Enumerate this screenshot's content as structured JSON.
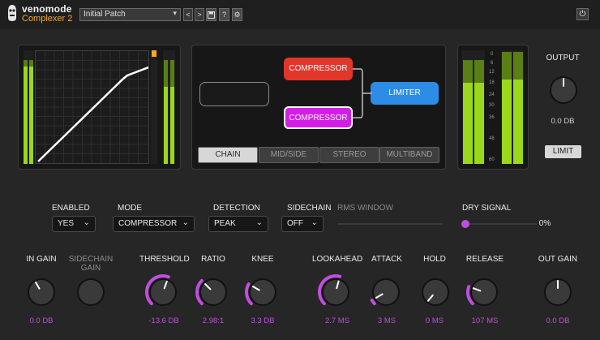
{
  "header": {
    "brand": "venomode",
    "product": "Complexer 2",
    "preset": "Initial Patch",
    "prev_label": "<",
    "next_label": ">",
    "save_label": "💾",
    "help_label": "?",
    "settings_label": "⚙",
    "power_label": "⏻"
  },
  "chain": {
    "block_top": "COMPRESSOR",
    "block_bottom": "COMPRESSOR",
    "block_limiter": "LIMITER",
    "colors": {
      "compressor_top": "#e0372a",
      "compressor_bottom": "#d41ee8",
      "limiter": "#2d8ce6"
    }
  },
  "tabs": [
    "CHAIN",
    "MID/SIDE",
    "STEREO",
    "MULTIBAND"
  ],
  "active_tab": "CHAIN",
  "output": {
    "label": "OUTPUT",
    "value": "0.0 DB",
    "limit_label": "LIMIT",
    "scale": [
      "0",
      "6",
      "12",
      "18",
      "24",
      "30",
      "36",
      "48",
      "60"
    ]
  },
  "settings": {
    "enabled": {
      "label": "ENABLED",
      "value": "YES"
    },
    "mode": {
      "label": "MODE",
      "value": "COMPRESSOR"
    },
    "detection": {
      "label": "DETECTION",
      "value": "PEAK"
    },
    "sidechain": {
      "label": "SIDECHAIN",
      "value": "OFF"
    },
    "rms_window": {
      "label": "RMS WINDOW"
    },
    "dry_signal": {
      "label": "DRY SIGNAL",
      "value": "0%",
      "level": 0
    }
  },
  "knobs": {
    "in_gain": {
      "label": "IN GAIN",
      "value": "0.0 DB"
    },
    "sidechain_gain": {
      "label": "SIDECHAIN GAIN",
      "value": ""
    },
    "threshold": {
      "label": "THRESHOLD",
      "value": "-13.6 DB"
    },
    "ratio": {
      "label": "RATIO",
      "value": "2.98:1"
    },
    "knee": {
      "label": "KNEE",
      "value": "3.3 DB"
    },
    "lookahead": {
      "label": "LOOKAHEAD",
      "value": "2.7 MS"
    },
    "attack": {
      "label": "ATTACK",
      "value": "3 MS"
    },
    "hold": {
      "label": "HOLD",
      "value": "0 MS"
    },
    "release": {
      "label": "RELEASE",
      "value": "107 MS"
    },
    "out_gain": {
      "label": "OUT GAIN",
      "value": "0.0 DB"
    }
  },
  "accent_color": "#c14de0",
  "meter_color": "#9ad81c"
}
